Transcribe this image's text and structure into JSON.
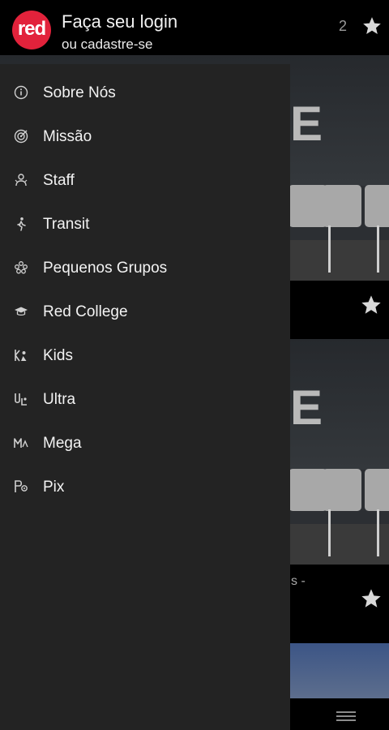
{
  "header": {
    "logo_text": "red",
    "login_title": "Faça seu login",
    "login_subtitle": "ou cadastre-se",
    "favorites_count": "2",
    "star_icon": "star-icon"
  },
  "background": {
    "card_letter": "E",
    "caption_fragment": "s -"
  },
  "drawer": {
    "items": [
      {
        "label": "Sobre Nós",
        "icon": "info-icon"
      },
      {
        "label": "Missão",
        "icon": "target-icon"
      },
      {
        "label": "Staff",
        "icon": "staff-icon"
      },
      {
        "label": "Transit",
        "icon": "walking-person-icon"
      },
      {
        "label": "Pequenos Grupos",
        "icon": "group-icon"
      },
      {
        "label": "Red College",
        "icon": "graduation-cap-icon"
      },
      {
        "label": "Kids",
        "icon": "kids-icon"
      },
      {
        "label": "Ultra",
        "icon": "ultra-icon"
      },
      {
        "label": "Mega",
        "icon": "mega-icon"
      },
      {
        "label": "Pix",
        "icon": "pix-icon"
      }
    ]
  },
  "colors": {
    "brand_red": "#e2223b",
    "drawer_bg": "#232323",
    "topbar_bg": "#000000"
  }
}
